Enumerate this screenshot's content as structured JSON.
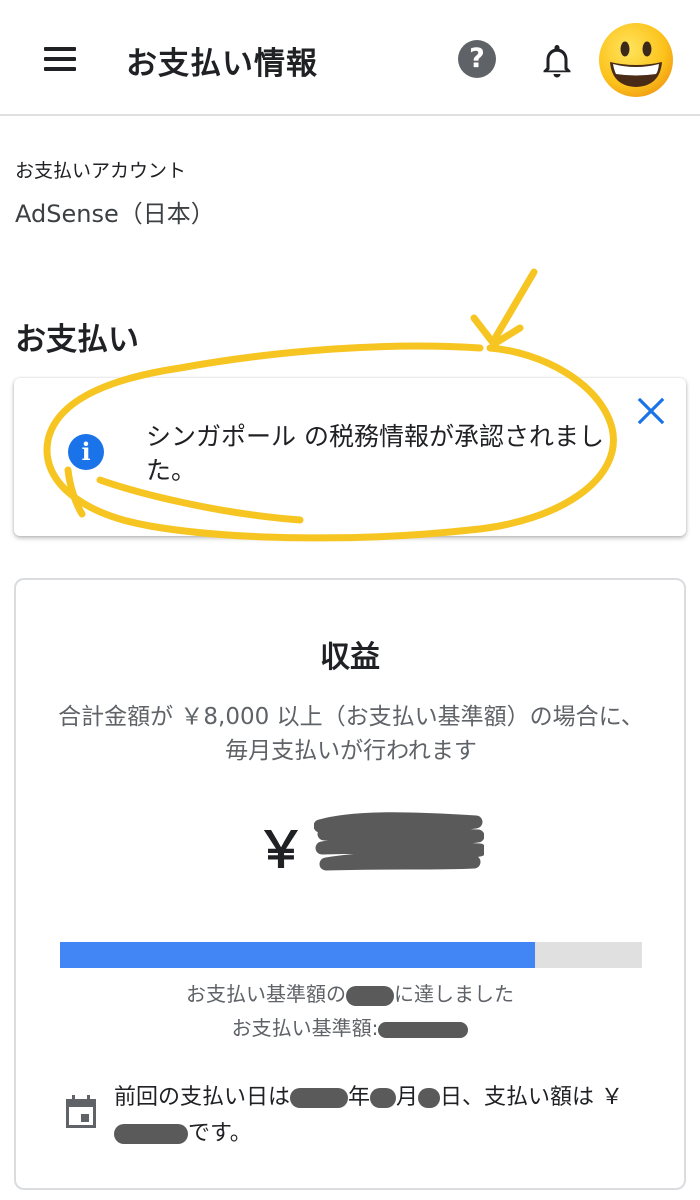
{
  "header": {
    "title": "お支払い情報",
    "help_symbol": "?",
    "menu_icon": "hamburger-menu-icon",
    "help_icon": "help-circle-icon",
    "bell_icon": "bell-icon",
    "avatar_icon": "grinning-face-emoji"
  },
  "account": {
    "label": "お支払いアカウント",
    "name": "AdSense（日本）"
  },
  "payments": {
    "section_title": "お支払い"
  },
  "notice": {
    "icon": "info-icon",
    "icon_glyph": "i",
    "message": "シンガポール の税務情報が承認されました。",
    "close_icon": "close-icon",
    "accent": "#1a73e8"
  },
  "earnings": {
    "title": "収益",
    "description": "合計金額が ￥8,000 以上（お支払い基準額）の場合に、毎月支払いが行われます",
    "currency_symbol": "￥",
    "progress_fraction": 0.816,
    "progress_color": "#4285f4",
    "reached_prefix": "お支払い基準額の",
    "reached_suffix": "に達しました",
    "threshold_label": "お支払い基準額:",
    "last_payment": {
      "icon": "calendar-icon",
      "part1": "前回の支払い日は",
      "year_suffix": "年",
      "month_suffix": "月",
      "day_suffix": "日、支払い額は ￥",
      "part_end": "です。"
    }
  },
  "annotation_color": "#f6c521"
}
